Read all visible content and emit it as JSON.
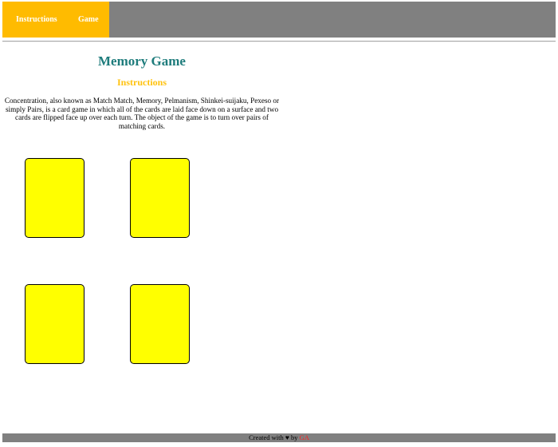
{
  "navbar": {
    "links": [
      {
        "label": "Instructions"
      },
      {
        "label": "Game"
      }
    ]
  },
  "main": {
    "title": "Memory Game",
    "subtitle": "Instructions",
    "description": "Concentration, also known as Match Match, Memory, Pelmanism, Shinkei-suijaku, Pexeso or simply Pairs, is a card game in which all of the cards are laid face down on a surface and two cards are flipped face up over each turn. The object of the game is to turn over pairs of matching cards."
  },
  "cards": {
    "count": 4,
    "color": "#FFFF00"
  },
  "footer": {
    "prefix": "Created with ",
    "heart": "♥",
    "by": " by ",
    "author": "GA"
  },
  "colors": {
    "navbar": "#808080",
    "nav_active": "#FFBB00",
    "title": "#1E7C7C",
    "subtitle": "#FFC20E",
    "author": "#FF2222"
  }
}
